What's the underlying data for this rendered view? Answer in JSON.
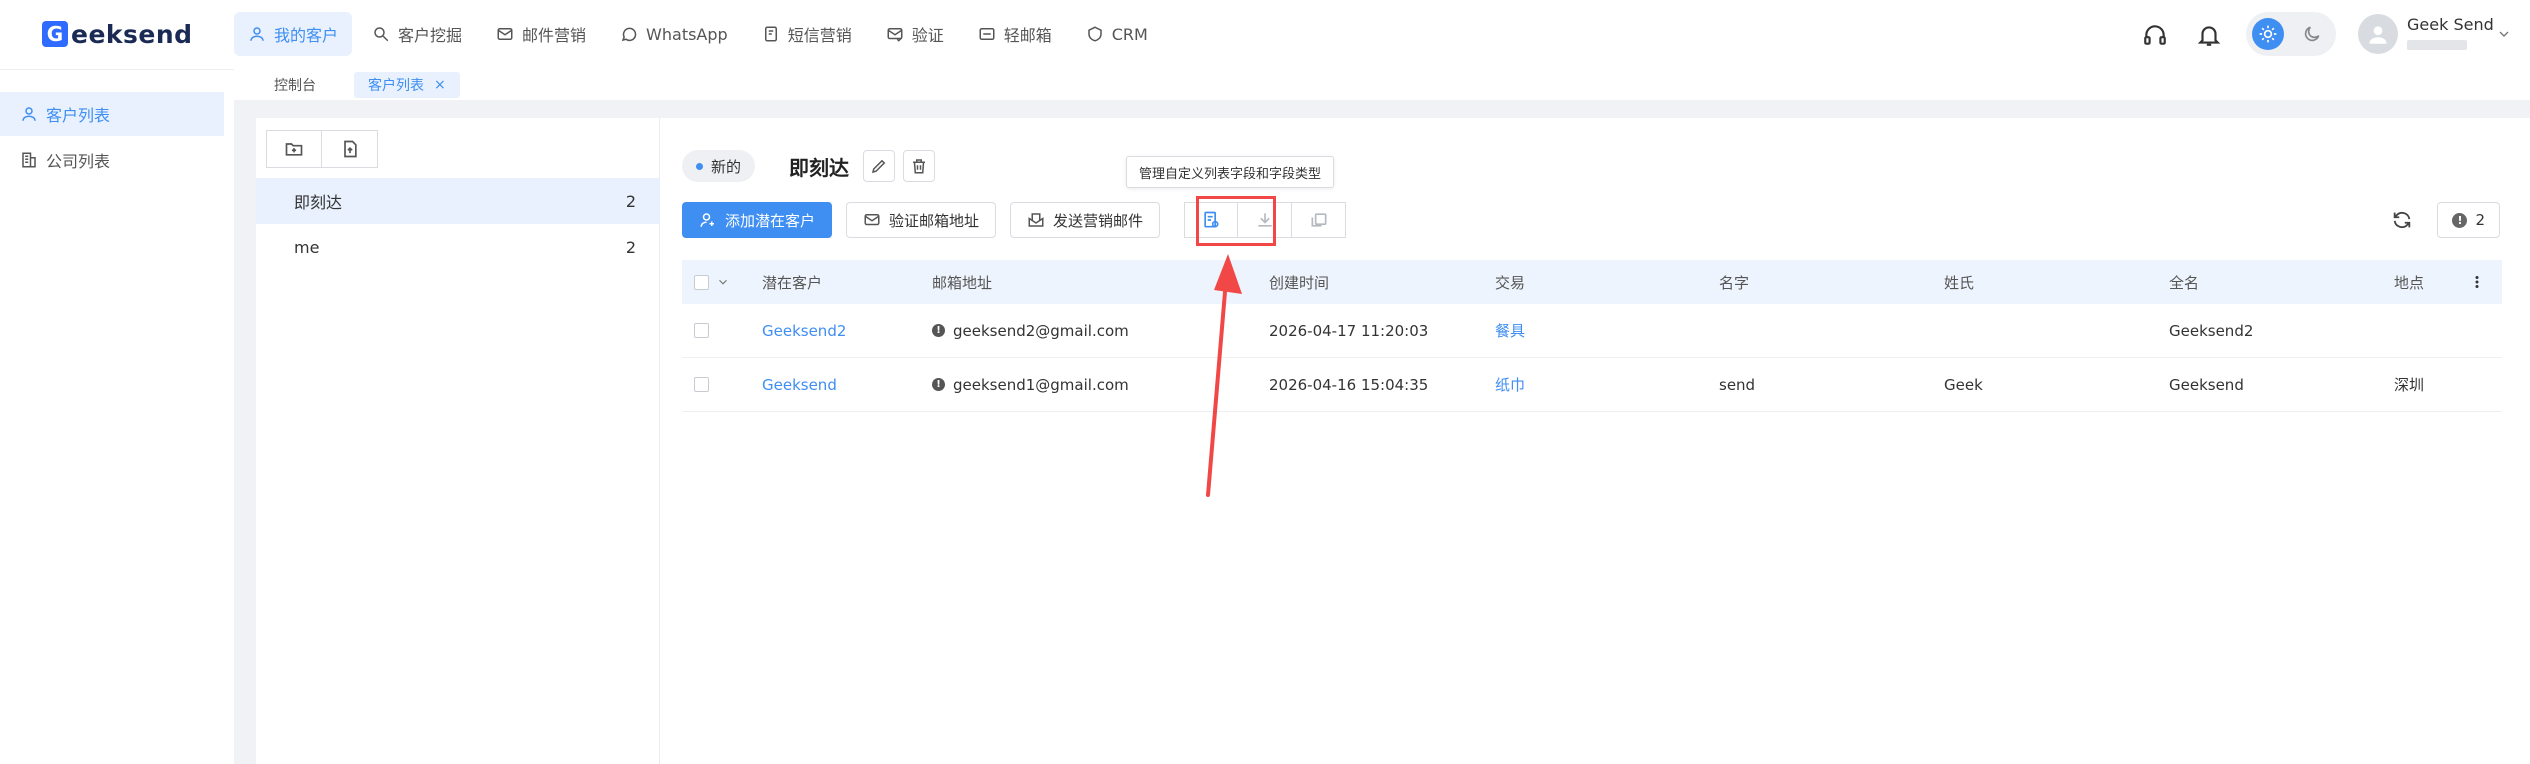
{
  "brand": {
    "logo_letter": "G",
    "logo_text": "eeksend"
  },
  "nav": [
    {
      "label": "我的客户",
      "icon": "user-icon",
      "active": true
    },
    {
      "label": "客户挖掘",
      "icon": "search-icon"
    },
    {
      "label": "邮件营销",
      "icon": "mail-icon"
    },
    {
      "label": "WhatsApp",
      "icon": "whatsapp-icon"
    },
    {
      "label": "短信营销",
      "icon": "sms-icon"
    },
    {
      "label": "验证",
      "icon": "verify-mail-icon"
    },
    {
      "label": "轻邮箱",
      "icon": "light-mail-icon"
    },
    {
      "label": "CRM",
      "icon": "crm-icon"
    }
  ],
  "user": {
    "name": "Geek Send"
  },
  "tabs": [
    {
      "label": "控制台"
    },
    {
      "label": "客户列表",
      "active": true,
      "close": "×"
    }
  ],
  "sidebar": {
    "items": [
      {
        "label": "客户列表",
        "icon": "user-icon",
        "active": true
      },
      {
        "label": "公司列表",
        "icon": "building-icon"
      }
    ]
  },
  "lists": [
    {
      "name": "即刻达",
      "count": "2",
      "active": true
    },
    {
      "name": "me",
      "count": "2"
    }
  ],
  "main": {
    "tag": "新的",
    "title": "即刻达",
    "buttons": {
      "add": "添加潜在客户",
      "verify": "验证邮箱地址",
      "send": "发送营销邮件"
    },
    "tooltip": "管理自定义列表字段和字段类型",
    "count": "2"
  },
  "table": {
    "headers": [
      "潜在客户",
      "邮箱地址",
      "创建时间",
      "交易",
      "名字",
      "姓氏",
      "全名",
      "地点"
    ],
    "rows": [
      {
        "prospect": "Geeksend2",
        "email": "geeksend2@gmail.com",
        "created": "2026-04-17 11:20:03",
        "deal": "餐具",
        "first": "",
        "last": "",
        "full": "Geeksend2",
        "location": ""
      },
      {
        "prospect": "Geeksend",
        "email": "geeksend1@gmail.com",
        "created": "2026-04-16 15:04:35",
        "deal": "纸巾",
        "first": "send",
        "last": "Geek",
        "full": "Geeksend",
        "location": "深圳"
      }
    ]
  },
  "colors": {
    "accent": "#3f8ef2",
    "highlight": "#f24747"
  }
}
